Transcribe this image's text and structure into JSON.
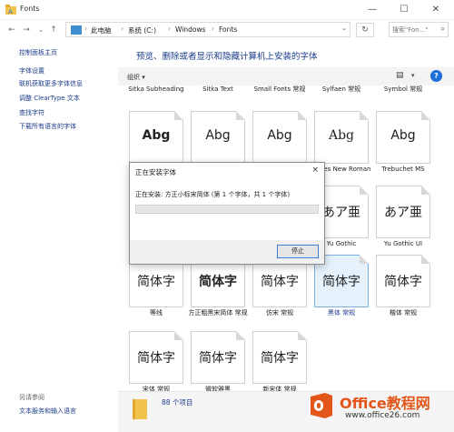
{
  "window": {
    "title": "Fonts"
  },
  "address": {
    "crumbs": [
      "此电脑",
      "系统 (C:)",
      "Windows",
      "Fonts"
    ],
    "search_placeholder": "搜索\"Fon...\""
  },
  "sidebar": {
    "links": [
      "控制面板主页",
      "字体设置",
      "联机获取更多字体信息",
      "调整 ClearType 文本",
      "查找字符",
      "下载所有语言的字体"
    ],
    "see_also_label": "另请参阅",
    "see_also_links": [
      "文本服务和输入语言"
    ]
  },
  "content": {
    "heading": "预览、删除或者显示和隐藏计算机上安装的字体",
    "organize_label": "组织 ▾",
    "help_label": "?"
  },
  "fonts": {
    "top_labels": [
      "Sitka Subheading",
      "Sitka Text",
      "Small Fonts 常规",
      "Sylfaen 常规",
      "Symbol 常规"
    ],
    "row2_samples": [
      "Abg",
      "Abg",
      "Abg",
      "Abg",
      "Abg"
    ],
    "row2_labels": [
      "",
      "",
      "",
      "Times New Roman",
      "Trebuchet MS"
    ],
    "row3_samples": [
      "",
      "",
      "",
      "あア亜",
      "あア亜"
    ],
    "row3_labels": [
      "",
      "",
      "",
      "Yu Gothic",
      "Yu Gothic UI"
    ],
    "row4_samples": [
      "简体字",
      "简体字",
      "简体字",
      "简体字",
      "简体字"
    ],
    "row4_labels": [
      "等线",
      "方正粗黑宋简体 常规",
      "仿宋 常规",
      "黑体 常规",
      "楷体 常规"
    ],
    "row5_samples": [
      "简体字",
      "简体字",
      "简体字"
    ],
    "row5_labels": [
      "宋体 常规",
      "微软雅黑",
      "新宋体 常规"
    ]
  },
  "status": {
    "count": "88 个项目"
  },
  "dialog": {
    "title": "正在安装字体",
    "close": "×",
    "message": "正在安装: 方正小标宋简体 (第 1 个字体，共 1 个字体)",
    "progress": 0,
    "stop_label": "停止"
  },
  "watermark": {
    "brand": "Office教程网",
    "url": "www.office26.com"
  },
  "icons": [
    "folder-icon",
    "refresh-icon",
    "search-icon",
    "back-icon",
    "forward-icon",
    "up-icon",
    "view-icon",
    "help-icon",
    "close-icon",
    "minimize-icon",
    "maximize-icon"
  ]
}
